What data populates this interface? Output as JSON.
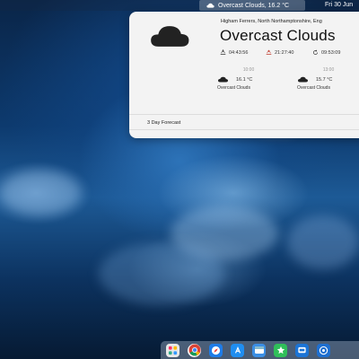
{
  "menubar": {
    "weather_item": "Overcast Clouds, 16.2 °C",
    "date": "Fri 30 Jun"
  },
  "weather": {
    "location": "Higham Ferrers, North Northamptonshire, Eng",
    "condition": "Overcast Clouds",
    "sunrise": "04:43:56",
    "sunset": "21:27:40",
    "day_length": "09:53:09",
    "hourly": [
      {
        "time": "10:00",
        "temp": "16.1 °C",
        "condition": "Overcast Clouds"
      },
      {
        "time": "13:00",
        "temp": "15.7 °C",
        "condition": "Overcast Clouds"
      }
    ],
    "forecast_label": "3 Day Forecast",
    "icons": {
      "main": "cloud-icon",
      "sunrise": "sunrise-icon",
      "sunset": "sunset-icon",
      "day_length": "refresh-clock-icon",
      "show": "eye-icon",
      "refresh": "refresh-icon"
    }
  },
  "dock": {
    "apps": [
      {
        "name": "launchpad-icon",
        "color": "#e8e8e8"
      },
      {
        "name": "chrome-icon",
        "color": "#ffffff"
      },
      {
        "name": "safari-icon",
        "color": "#1e7ce8"
      },
      {
        "name": "app-store-icon",
        "color": "#1f8ef1"
      },
      {
        "name": "finder-icon",
        "color": "#3b8fe5"
      },
      {
        "name": "green-app-icon",
        "color": "#2fbf5a"
      },
      {
        "name": "blue-app-icon",
        "color": "#1b74d6"
      },
      {
        "name": "settings-app-icon",
        "color": "#1e6fd0"
      }
    ]
  }
}
